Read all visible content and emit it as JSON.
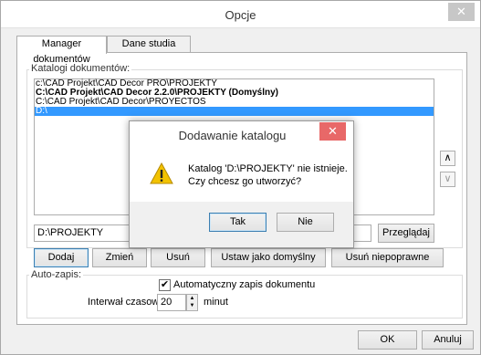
{
  "window": {
    "title": "Opcje",
    "close_glyph": "✕"
  },
  "tabs": [
    {
      "label": "Manager dokumentów",
      "active": true
    },
    {
      "label": "Dane studia",
      "active": false
    }
  ],
  "catalogs": {
    "group_label": "Katalogi dokumentów:",
    "items": [
      {
        "text": "c:\\CAD Projekt\\CAD Decor PRO\\PROJEKTY",
        "bold": false,
        "selected": false
      },
      {
        "text": "C:\\CAD Projekt\\CAD Decor 2.2.0\\PROJEKTY  (Domyślny)",
        "bold": true,
        "selected": false
      },
      {
        "text": "C:\\CAD Projekt\\CAD Decor\\PROYECTOS",
        "bold": false,
        "selected": false
      },
      {
        "text": "D:\\",
        "bold": false,
        "selected": true
      }
    ],
    "move_up_glyph": "∧",
    "move_down_glyph": "∨",
    "path_value": "D:\\PROJEKTY",
    "browse_label": "Przeglądaj",
    "buttons": {
      "add": "Dodaj",
      "change": "Zmień",
      "remove": "Usuń",
      "set_default": "Ustaw jako domyślny",
      "remove_invalid": "Usuń niepoprawne"
    }
  },
  "autosave": {
    "group_label": "Auto-zapis:",
    "checkbox_label": "Automatyczny zapis dokumentu",
    "checked": true,
    "interval_label": "Interwał czasowy:",
    "interval_value": "20",
    "interval_unit": "minut"
  },
  "footer": {
    "ok_label": "OK",
    "cancel_label": "Anuluj"
  },
  "dialog": {
    "title": "Dodawanie katalogu",
    "close_glyph": "✕",
    "message_line1": "Katalog 'D:\\PROJEKTY' nie istnieje.",
    "message_line2": "Czy chcesz go utworzyć?",
    "icon": "warning-icon",
    "yes_label": "Tak",
    "no_label": "Nie"
  },
  "colors": {
    "selection": "#3399ff",
    "dialog_close": "#e86868",
    "warning": "#f2c200"
  }
}
